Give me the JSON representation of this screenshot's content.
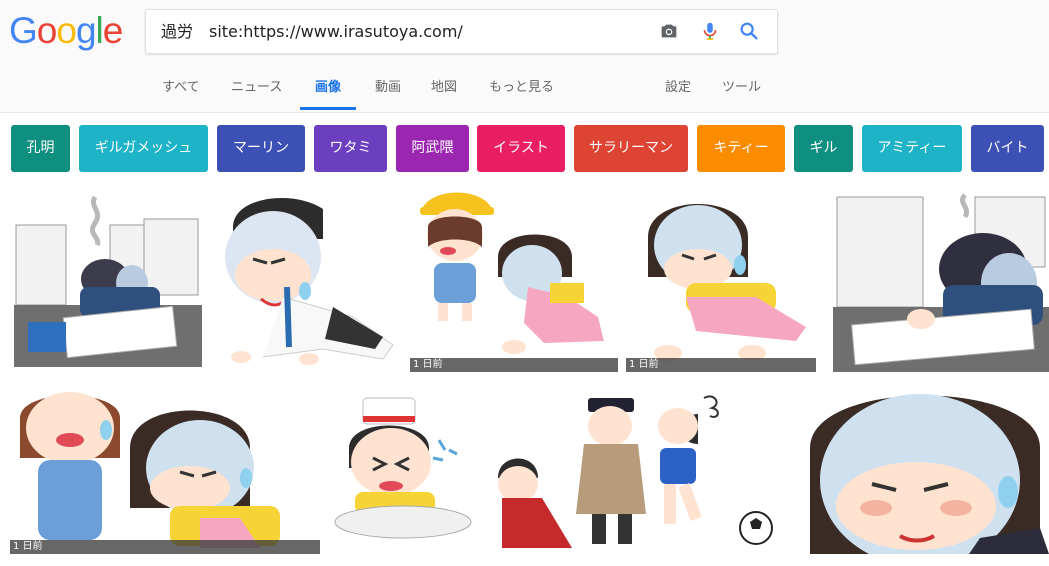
{
  "logo": {
    "letters": [
      "G",
      "o",
      "o",
      "g",
      "l",
      "e"
    ],
    "colors": [
      "#4285f4",
      "#ea4335",
      "#fbbc05",
      "#4285f4",
      "#34a853",
      "#ea4335"
    ]
  },
  "search": {
    "query": "過労　site:https://www.irasutoya.com/"
  },
  "icons": {
    "camera": "camera-icon",
    "mic": "microphone-icon",
    "search": "search-icon"
  },
  "tabs": {
    "all": "すべて",
    "news": "ニュース",
    "images": "画像",
    "videos": "動画",
    "maps": "地図",
    "more": "もっと見る",
    "settings": "設定",
    "tools": "ツール"
  },
  "chips": [
    {
      "label": "孔明",
      "color": "#0f8f80"
    },
    {
      "label": "ギルガメッシュ",
      "color": "#1eb3c7"
    },
    {
      "label": "マーリン",
      "color": "#3d50b3"
    },
    {
      "label": "ワタミ",
      "color": "#6b3fc0"
    },
    {
      "label": "阿武隈",
      "color": "#9b27b0"
    },
    {
      "label": "イラスト",
      "color": "#e91e63"
    },
    {
      "label": "サラリーマン",
      "color": "#de4434"
    },
    {
      "label": "キティー",
      "color": "#fb8c00"
    },
    {
      "label": "ギル",
      "color": "#0f8f80"
    },
    {
      "label": "アミティー",
      "color": "#1eb3c7"
    },
    {
      "label": "バイト",
      "color": "#3d50b3"
    }
  ],
  "results": {
    "r1": {
      "age": ""
    },
    "r2": {
      "age": ""
    },
    "r3": {
      "age": "1 日前"
    },
    "r4": {
      "age": "1 日前"
    },
    "r5": {
      "age": ""
    },
    "r6": {
      "age": "1 日前"
    },
    "r7": {
      "age": ""
    },
    "r8": {
      "age": ""
    },
    "r9": {
      "age": ""
    }
  }
}
